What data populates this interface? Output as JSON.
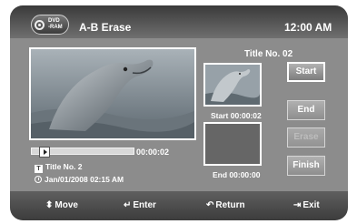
{
  "header": {
    "disc_line1": "DVD",
    "disc_line2": "-RAM",
    "title": "A-B Erase",
    "clock": "12:00 AM"
  },
  "player": {
    "elapsed": "00:00:02",
    "progress": 0.04,
    "title": "Title No. 2",
    "datetime": "Jan/01/2008  02:15 AM"
  },
  "side": {
    "title_no": "Title No. 02",
    "start_time": "Start 00:00:02",
    "end_time": "End 00:00:00"
  },
  "buttons": {
    "start": "Start",
    "end": "End",
    "erase": "Erase",
    "finish": "Finish"
  },
  "footer": {
    "move": "Move",
    "enter": "Enter",
    "return": "Return",
    "exit": "Exit"
  }
}
